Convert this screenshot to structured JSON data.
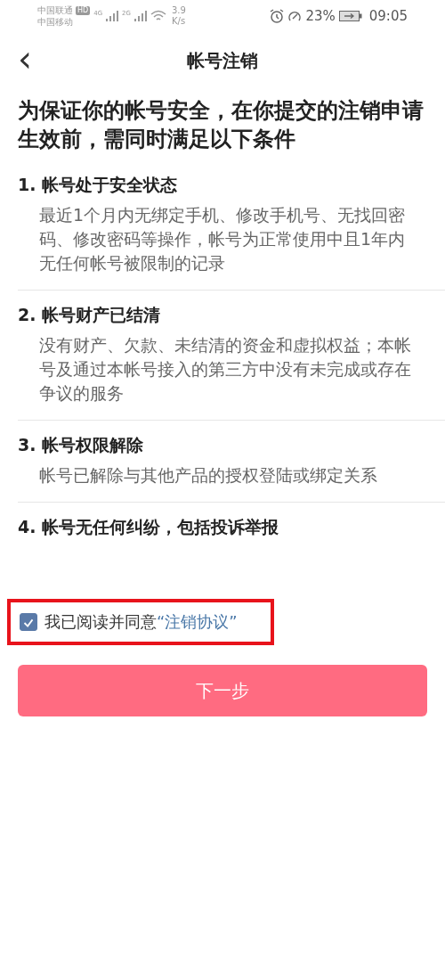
{
  "status_bar": {
    "carrier_1": "中国联通",
    "hd": "HD",
    "net_1": "4G",
    "net_2": "2G",
    "speed": "3.9",
    "speed_unit": "K/s",
    "carrier_2": "中国移动",
    "battery": "23%",
    "time": "09:05"
  },
  "header": {
    "back": "‹",
    "title": "帐号注销"
  },
  "intro": "为保证你的帐号安全，在你提交的注销申请生效前，需同时满足以下条件",
  "conditions": [
    {
      "title": "1. 帐号处于安全状态",
      "body": "最近1个月内无绑定手机、修改手机号、无找回密码、修改密码等操作，帐号为正常使用中且1年内无任何帐号被限制的记录"
    },
    {
      "title": "2. 帐号财产已结清",
      "body": "没有财产、欠款、未结清的资金和虚拟权益；本帐号及通过本帐号接入的第三方中没有未完成或存在争议的服务"
    },
    {
      "title": "3. 帐号权限解除",
      "body": "帐号已解除与其他产品的授权登陆或绑定关系"
    },
    {
      "title": "4. 帐号无任何纠纷，包括投诉举报"
    }
  ],
  "agreement": {
    "checked": true,
    "label": "我已阅读并同意",
    "link": "“注销协议”"
  },
  "next_button": "下一步"
}
